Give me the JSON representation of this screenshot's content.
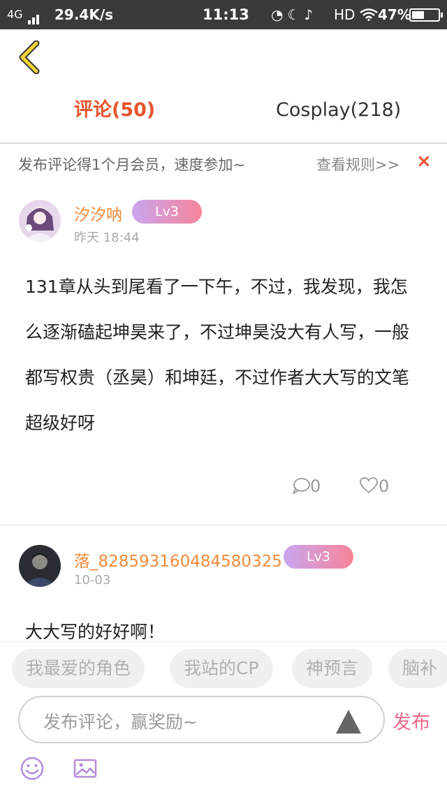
{
  "status_bar": {
    "network": "4G",
    "speed": "29.4K/s",
    "time": "11:13",
    "hd": "HD",
    "battery": "47%",
    "battery_level": 0.47
  },
  "tabs": [
    {
      "label": "评论(50)",
      "active": true
    },
    {
      "label": "Cosplay(218)",
      "active": false
    }
  ],
  "notice": {
    "text": "发布评论得1个月会员，速度参加~",
    "rules_link": "查看规则>>",
    "close": "×"
  },
  "comments": [
    {
      "username": "汐汐呐",
      "level": "Lv3",
      "time": "昨天 18:44",
      "text": "131章从头到尾看了一下午，不过，我发现，我怎么逐渐磕起坤昊来了，不过坤昊没大有人写，一般都写权贵（丞昊）和坤廷，不过作者大大写的文笔超级好呀",
      "reply_count": "0",
      "like_count": "0"
    },
    {
      "username": "落_828593160484580325",
      "level": "Lv3",
      "time": "10-03",
      "text": "大大写的好好啊！"
    }
  ],
  "tags": [
    "我最爱的角色",
    "我站的CP",
    "神预言",
    "脑补"
  ],
  "input": {
    "placeholder": "发布评论，赢奖励~",
    "publish_label": "发布"
  },
  "colors": {
    "accent": "#e8542e",
    "username": "#f08a3c",
    "publish": "#ee6a8a",
    "icon_purple": "#b48ad8"
  }
}
